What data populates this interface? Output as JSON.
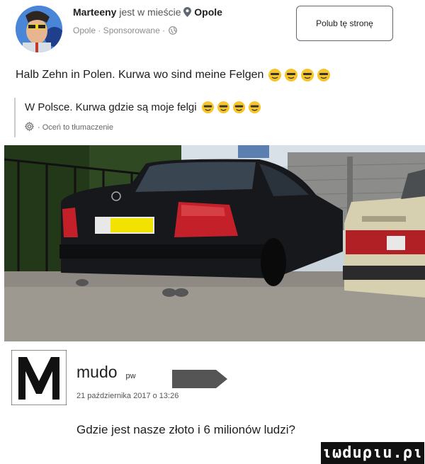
{
  "post": {
    "author": "Marteeny",
    "checkin_verb": "jest w mieście",
    "city": "Opole",
    "meta": "Opole · Sponsorowane ·",
    "like_button": "Polub tę stronę",
    "text": "Halb Zehn in Polen. Kurwa wo sind meine Felgen",
    "translation": "W Polsce. Kurwa gdzie są moje felgi",
    "translation_meta": "· Oceń to tłumaczenie",
    "emoji_count": 4
  },
  "comment": {
    "name": "mudo",
    "badge": "pw",
    "date": "21 października 2017 o 13:26",
    "text": "Gdzie jest nasze złoto i 6 milionów ludzi?"
  },
  "watermark": "ιωduριu.ρι",
  "colors": {
    "emoji_face": "#f7c52a",
    "meta_gray": "#8a8d91",
    "car_black": "#16181b",
    "taillight_red": "#c4202a"
  },
  "icons": [
    "location-pin-icon",
    "globe-icon",
    "gear-icon",
    "emoji-icon",
    "m-logo-icon",
    "arrow-badge-icon"
  ]
}
